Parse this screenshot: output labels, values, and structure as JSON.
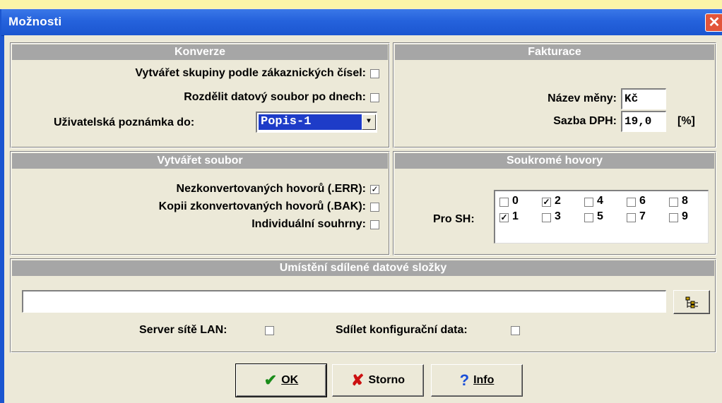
{
  "window": {
    "title": "Možnosti",
    "close_glyph": "✕"
  },
  "konverze": {
    "header": "Konverze",
    "group_by_customer_label": "Vytvářet skupiny podle zákaznických čísel:",
    "group_by_customer_checked": false,
    "split_by_days_label": "Rozdělit datový soubor po dnech:",
    "split_by_days_checked": false,
    "user_note_label": "Uživatelská poznámka do:",
    "user_note_value": "Popis-1"
  },
  "fakturace": {
    "header": "Fakturace",
    "currency_label": "Název měny:",
    "currency_value": "Kč",
    "vat_label": "Sazba DPH:",
    "vat_value": "19,0",
    "vat_unit": "[%]"
  },
  "vytvaret_soubor": {
    "header": "Vytvářet soubor",
    "err_label": "Nezkonvertovaných hovorů (.ERR):",
    "err_checked": true,
    "bak_label": "Kopii zkonvertovaných hovorů (.BAK):",
    "bak_checked": false,
    "individual_label": "Individuální souhrny:",
    "individual_checked": false
  },
  "soukrome_hovory": {
    "header": "Soukromé hovory",
    "label": "Pro SH:",
    "items": [
      {
        "label": "0",
        "checked": false
      },
      {
        "label": "1",
        "checked": true
      },
      {
        "label": "2",
        "checked": true
      },
      {
        "label": "3",
        "checked": false
      },
      {
        "label": "4",
        "checked": false
      },
      {
        "label": "5",
        "checked": false
      },
      {
        "label": "6",
        "checked": false
      },
      {
        "label": "7",
        "checked": false
      },
      {
        "label": "8",
        "checked": false
      },
      {
        "label": "9",
        "checked": false
      }
    ]
  },
  "shared_folder": {
    "header": "Umístění sdílené datové složky",
    "path_value": "",
    "lan_server_label": "Server sítě LAN:",
    "lan_server_checked": false,
    "share_config_label": "Sdílet konfigurační data:",
    "share_config_checked": false
  },
  "buttons": {
    "ok_label": "OK",
    "cancel_label": "Storno",
    "info_label": "Info",
    "ok_icon": "✔",
    "cancel_icon": "✘",
    "info_icon": "?"
  },
  "colors": {
    "ok_icon": "#1a8c1a",
    "cancel_icon": "#cc1111",
    "info_icon": "#1a4fd8"
  }
}
